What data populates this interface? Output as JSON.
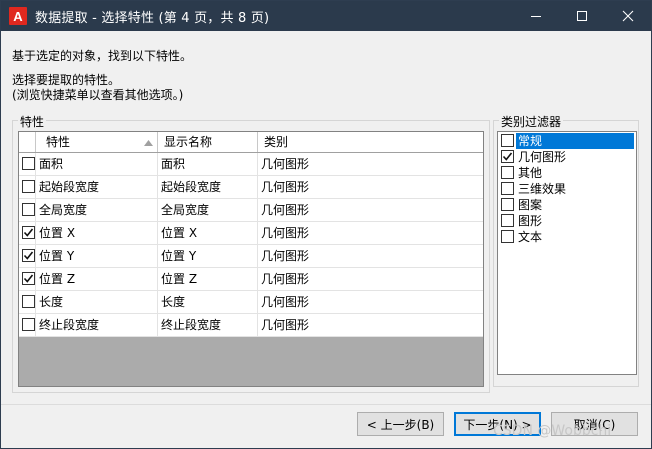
{
  "window": {
    "title": "数据提取 - 选择特性 (第 4 页，共 8 页)",
    "controls": {
      "minimize": "minimize-icon",
      "maximize": "maximize-icon",
      "close": "close-icon"
    }
  },
  "intro": {
    "line1": "基于选定的对象，找到以下特性。",
    "line2": "选择要提取的特性。",
    "line3": "(浏览快捷菜单以查看其他选项。)"
  },
  "properties": {
    "group_title": "特性",
    "headers": [
      "特性",
      "显示名称",
      "类别"
    ],
    "rows": [
      {
        "checked": false,
        "property": "面积",
        "display": "面积",
        "category": "几何图形"
      },
      {
        "checked": false,
        "property": "起始段宽度",
        "display": "起始段宽度",
        "category": "几何图形"
      },
      {
        "checked": false,
        "property": "全局宽度",
        "display": "全局宽度",
        "category": "几何图形"
      },
      {
        "checked": true,
        "property": "位置 X",
        "display": "位置 X",
        "category": "几何图形"
      },
      {
        "checked": true,
        "property": "位置 Y",
        "display": "位置 Y",
        "category": "几何图形"
      },
      {
        "checked": true,
        "property": "位置 Z",
        "display": "位置 Z",
        "category": "几何图形"
      },
      {
        "checked": false,
        "property": "长度",
        "display": "长度",
        "category": "几何图形"
      },
      {
        "checked": false,
        "property": "终止段宽度",
        "display": "终止段宽度",
        "category": "几何图形"
      }
    ]
  },
  "filter": {
    "title": "类别过滤器",
    "items": [
      {
        "label": "常规",
        "checked": false,
        "selected": true
      },
      {
        "label": "几何图形",
        "checked": true,
        "selected": false
      },
      {
        "label": "其他",
        "checked": false,
        "selected": false
      },
      {
        "label": "三维效果",
        "checked": false,
        "selected": false
      },
      {
        "label": "图案",
        "checked": false,
        "selected": false
      },
      {
        "label": "图形",
        "checked": false,
        "selected": false
      },
      {
        "label": "文本",
        "checked": false,
        "selected": false
      }
    ]
  },
  "buttons": {
    "back": "< 上一步(B)",
    "next": "下一步(N) >",
    "cancel": "取消(C)"
  },
  "watermark": "CSDN @Wobbchi",
  "colors": {
    "titlebar": "#2b3a4c",
    "accent": "#0078d7",
    "app_icon": "#e0281f"
  }
}
